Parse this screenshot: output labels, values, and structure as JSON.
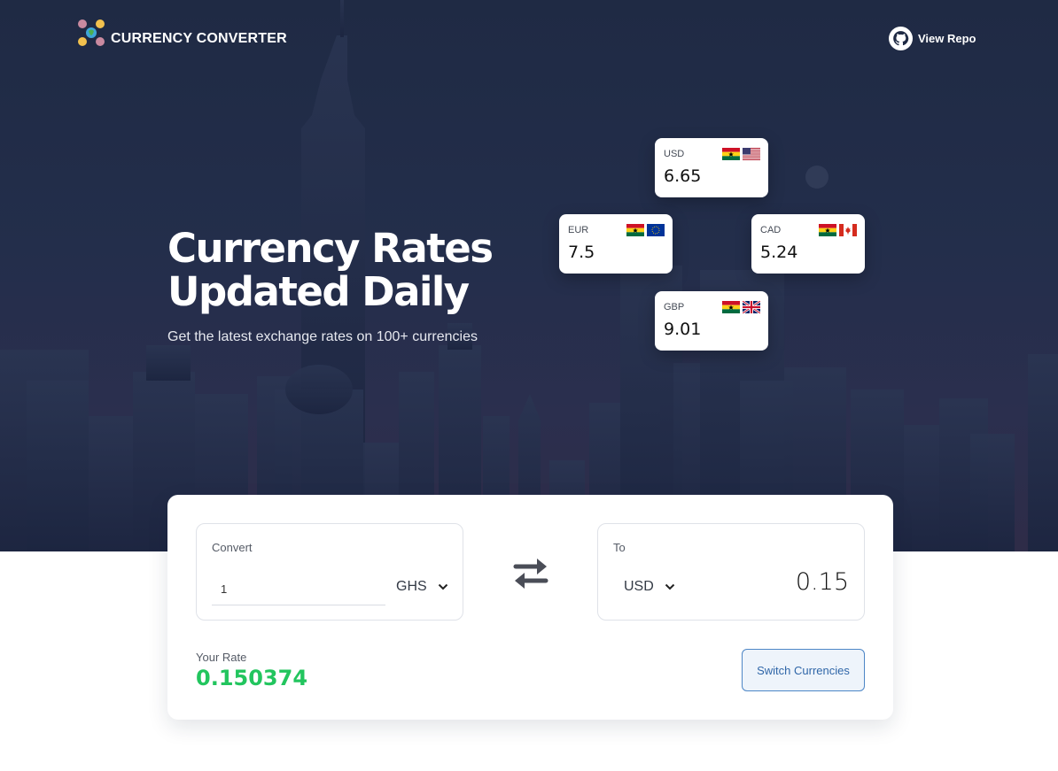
{
  "nav": {
    "title": "CURRENCY CONVERTER",
    "repo_label": "View Repo"
  },
  "hero": {
    "headline_line1": "Currency Rates",
    "headline_line2": "Updated Daily",
    "subtitle": "Get the latest exchange rates on 100+ currencies"
  },
  "rates": [
    {
      "code": "USD",
      "value": "6.65",
      "flags": [
        "ghana-flag-icon",
        "usa-flag-icon"
      ]
    },
    {
      "code": "EUR",
      "value": "7.5",
      "flags": [
        "ghana-flag-icon",
        "eu-flag-icon"
      ]
    },
    {
      "code": "CAD",
      "value": "5.24",
      "flags": [
        "ghana-flag-icon",
        "canada-flag-icon"
      ]
    },
    {
      "code": "GBP",
      "value": "9.01",
      "flags": [
        "ghana-flag-icon",
        "uk-flag-icon"
      ]
    }
  ],
  "converter": {
    "from_label": "Convert",
    "amount": "1",
    "from_currency": "GHS",
    "to_label": "To",
    "to_currency": "USD",
    "result": "0.15",
    "rate_label": "Your Rate",
    "rate_value": "0.150374",
    "switch_label": "Switch Currencies"
  },
  "colors": {
    "hero_bg": "#1f2a44",
    "rate_green": "#22c55e",
    "button_border": "#4d86c6",
    "button_text": "#2f66a8"
  }
}
